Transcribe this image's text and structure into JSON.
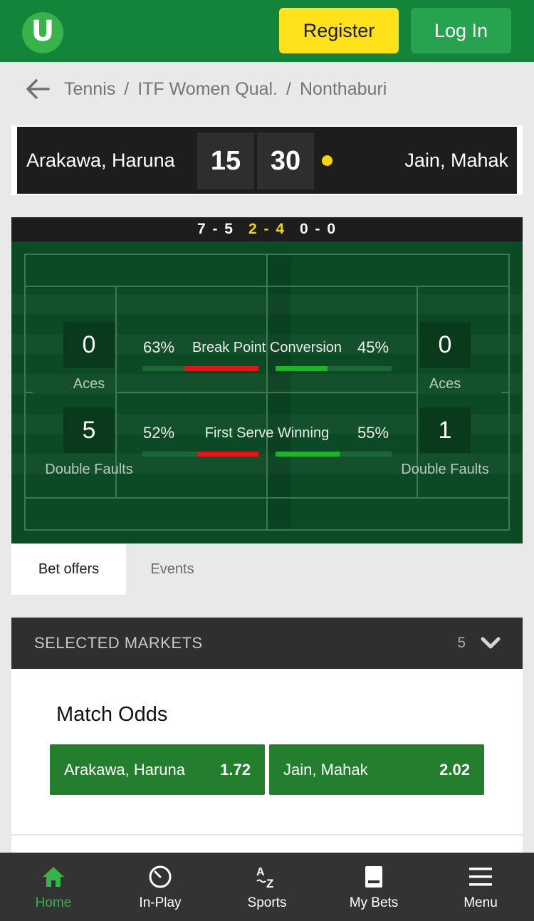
{
  "header": {
    "logo_letter": "U",
    "register_label": "Register",
    "login_label": "Log In"
  },
  "breadcrumb": {
    "items": [
      "Tennis",
      "ITF Women Qual.",
      "Nonthaburi"
    ],
    "separator": "/"
  },
  "scoreboard": {
    "player1": "Arakawa, Haruna",
    "player2": "Jain, Mahak",
    "points1": "15",
    "points2": "30",
    "serving": "player2"
  },
  "sets": {
    "set1": "7 - 5",
    "set2": "2 - 4",
    "set3": "0 - 0"
  },
  "stats": {
    "left_aces": "0",
    "right_aces": "0",
    "aces_label": "Aces",
    "left_double_faults": "5",
    "right_double_faults": "1",
    "double_faults_label": "Double Faults",
    "break_point": {
      "title": "Break Point Conversion",
      "left_pct": "63%",
      "right_pct": "45%",
      "left_value": 0.63,
      "right_value": 0.45
    },
    "first_serve": {
      "title": "First Serve Winning",
      "left_pct": "52%",
      "right_pct": "55%",
      "left_value": 0.52,
      "right_value": 0.55
    }
  },
  "tabs": {
    "bet_offers": "Bet offers",
    "events": "Events"
  },
  "markets": {
    "title": "SELECTED MARKETS",
    "count": "5",
    "match_odds": {
      "title": "Match Odds",
      "options": [
        {
          "name": "Arakawa, Haruna",
          "price": "1.72"
        },
        {
          "name": "Jain, Mahak",
          "price": "2.02"
        }
      ]
    }
  },
  "bottom_nav": {
    "home": "Home",
    "in_play": "In-Play",
    "sports": "Sports",
    "my_bets": "My Bets",
    "menu": "Menu"
  },
  "colors": {
    "brand_green": "#15843b",
    "register_yellow": "#ffe21c",
    "court_green": "#0c4a25",
    "odds_green": "#237e2e",
    "stat_red": "#e2161b",
    "stat_green": "#1fb22a"
  }
}
